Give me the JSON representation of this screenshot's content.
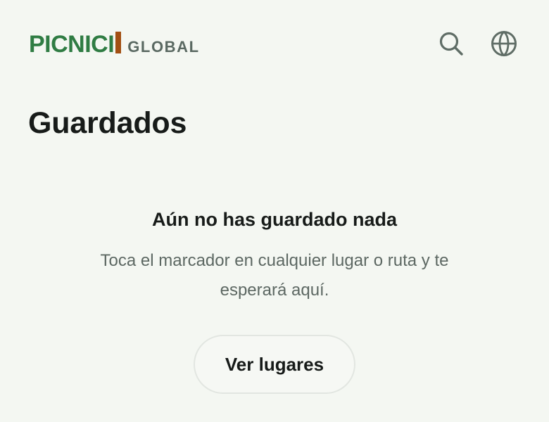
{
  "header": {
    "brand": "PICNICI",
    "brand_sub": "GLOBAL",
    "brand_colors": {
      "green": "#2f7c43",
      "accent": "#a24f13",
      "subtext": "#5a6962"
    },
    "icons": {
      "search": "search-icon",
      "language": "globe-icon"
    }
  },
  "page": {
    "title": "Guardados"
  },
  "empty_state": {
    "title": "Aún no has guardado nada",
    "description": "Toca el marcador en cualquier lugar o ruta y te esperará aquí.",
    "button_label": "Ver lugares"
  },
  "colors": {
    "background": "#f4f7f2",
    "text": "#171b19",
    "muted_text": "#5d6863",
    "icon": "#5f6d66",
    "button_border": "#e2e6e1"
  }
}
